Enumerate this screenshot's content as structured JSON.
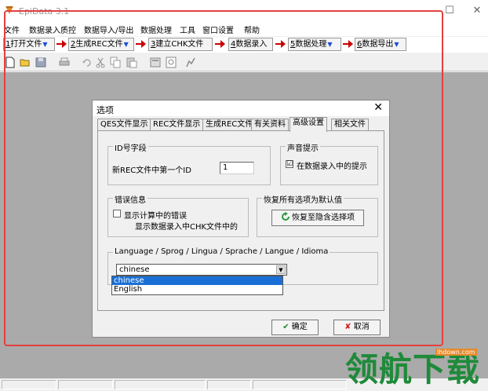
{
  "window": {
    "title": "EpiData 3.1",
    "controls": [
      "—",
      "☐",
      "✕"
    ]
  },
  "menubar": {
    "items": [
      "文件",
      "数据录入质控",
      "数据导入/导出",
      "数据处理",
      "工具",
      "窗口设置",
      "帮助"
    ]
  },
  "stepbar": {
    "steps": [
      {
        "num": "1",
        "label": "打开文件"
      },
      {
        "num": "2",
        "label": "生成REC文件"
      },
      {
        "num": "3",
        "label": "建立CHK文件"
      },
      {
        "num": "4",
        "label": "数据录入"
      },
      {
        "num": "5",
        "label": "数据处理"
      },
      {
        "num": "6",
        "label": "数据导出"
      }
    ]
  },
  "dialog": {
    "title": "选项",
    "close": "✕",
    "tabs": [
      "QES文件显示",
      "REC文件显示",
      "生成REC文件",
      "有关资料",
      "高级设置",
      "相关文件"
    ],
    "active_tab": "高级设置",
    "id_group": {
      "legend": "ID号字段",
      "label": "新REC文件中第一个ID",
      "value": "1"
    },
    "sound_group": {
      "legend": "声音提示",
      "checkbox_label": "在数据录入中的提示",
      "checked": "☑"
    },
    "error_group": {
      "legend": "错误信息",
      "checkbox_label": "显示计算中的错误",
      "line2": "显示数据录入中CHK文件中的"
    },
    "reset_group": {
      "legend": "恢复所有选项为默认值",
      "button_label": "恢复至隐含选择项"
    },
    "language_group": {
      "legend": "Language / Sprog / Lingua / Sprache / Langue / Idioma",
      "selected": "chinese",
      "options": [
        "chinese",
        "English"
      ]
    },
    "ok_label": "确定",
    "cancel_label": "取消"
  },
  "watermark": {
    "text": "领航下载",
    "site": "lhdown.com"
  },
  "colors": {
    "highlight_frame": "#e53f3f",
    "selection": "#1a6fd6",
    "watermark": "#1f8a3a"
  }
}
